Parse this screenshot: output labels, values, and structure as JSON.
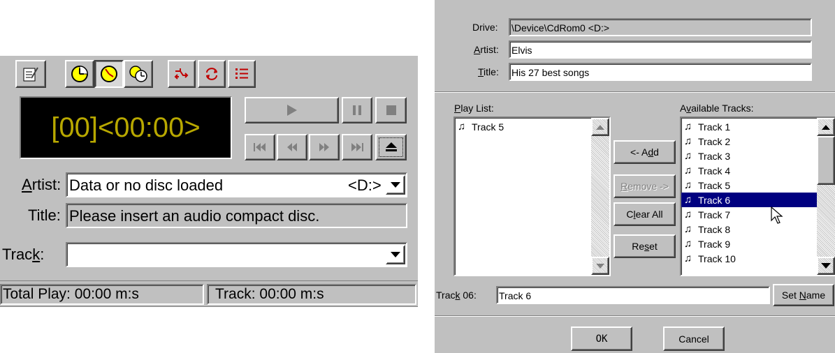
{
  "player": {
    "display": "[00]<00:00>",
    "artist_label": "Artist:",
    "artist_value": "Data or no disc loaded",
    "artist_drive": "<D:>",
    "title_label": "Title:",
    "title_value": "Please insert an audio compact disc.",
    "track_label": "Track:",
    "track_value": "",
    "status_total": "Total Play: 00:00 m:s",
    "status_track": "Track: 00:00 m:s",
    "display_color": "#b8a800",
    "toolbar_icons": [
      "edit-playlist-icon",
      "track-time-elapsed-icon",
      "track-time-remaining-icon",
      "disc-time-remaining-icon",
      "random-order-icon",
      "continuous-play-icon",
      "intro-play-icon"
    ]
  },
  "dialog": {
    "drive_label": "Drive:",
    "drive_value": "\\Device\\CdRom0  <D:>",
    "artist_label": "Artist:",
    "artist_value": "Elvis",
    "title_label": "Title:",
    "title_value": "His 27 best songs",
    "playlist_label": "Play List:",
    "playlist": [
      "Track 5"
    ],
    "available_label": "Available Tracks:",
    "available": [
      "Track 1",
      "Track 2",
      "Track 3",
      "Track 4",
      "Track 5",
      "Track 6",
      "Track 7",
      "Track 8",
      "Track 9",
      "Track 10"
    ],
    "selected_track": "Track 6",
    "add_label": "<- Add",
    "remove_label": "Remove ->",
    "clear_label": "Clear All",
    "reset_label": "Reset",
    "track_edit_label": "Track 06:",
    "track_edit_value": "Track 6",
    "set_name_label": "Set Name",
    "ok_label": "OK",
    "cancel_label": "Cancel",
    "selection_color": "#000080"
  }
}
